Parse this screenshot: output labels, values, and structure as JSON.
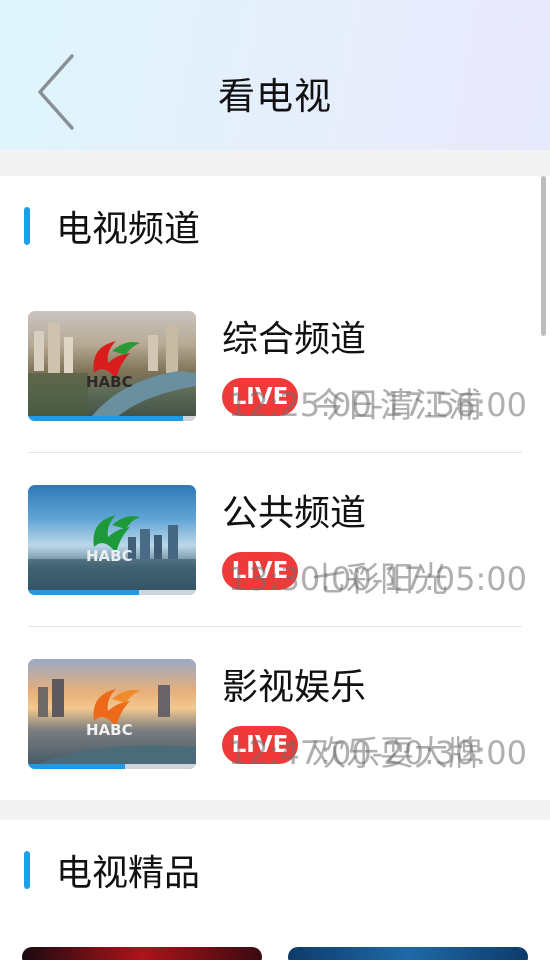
{
  "header": {
    "title": "看电视"
  },
  "section_channels": {
    "title": "电视频道"
  },
  "channels": [
    {
      "name": "综合频道",
      "live": "LIVE",
      "time": "12:25:00-17:56:00",
      "program": "今日清江浦",
      "progress": 0.92
    },
    {
      "name": "公共频道",
      "live": "LIVE",
      "time": "13:30:00-17:05:00",
      "program": "七彩阳光",
      "progress": 0.66
    },
    {
      "name": "影视娱乐",
      "live": "LIVE",
      "time": "12:47:00-20:30:00",
      "program": "欢乐耍大牌",
      "progress": 0.58
    }
  ],
  "section_featured": {
    "title": "电视精品"
  },
  "logo_text": "HABC",
  "colors": {
    "accent": "#1ea0e8",
    "live": "#f03a3a"
  }
}
